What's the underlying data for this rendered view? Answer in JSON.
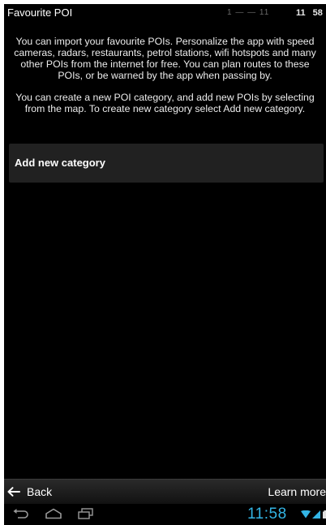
{
  "header": {
    "title": "Favourite POI",
    "status_faint": "1 — — 11",
    "status_time": "11 58"
  },
  "intro": {
    "paragraph_1": "You can import your favourite POIs. Personalize the app with speed cameras, radars, restaurants, petrol stations, wifi hotspots and many other POIs from the internet for free. You can plan routes to these POIs, or be warned by the app when passing by.",
    "paragraph_2": "You can create a new POI category, and add new POIs by selecting from the map. To create new category select Add new category."
  },
  "list": {
    "add_category_label": "Add new category"
  },
  "actionbar": {
    "back_label": "Back",
    "learn_more_label": "Learn more"
  },
  "systembar": {
    "clock": "11:58",
    "icons": [
      "back-nav-icon",
      "home-nav-icon",
      "recent-apps-icon",
      "wifi-icon",
      "signal-icon",
      "battery-icon"
    ]
  },
  "colors": {
    "background": "#000000",
    "row": "#212121",
    "text": "#ffffff",
    "clock": "#33b5e5"
  }
}
